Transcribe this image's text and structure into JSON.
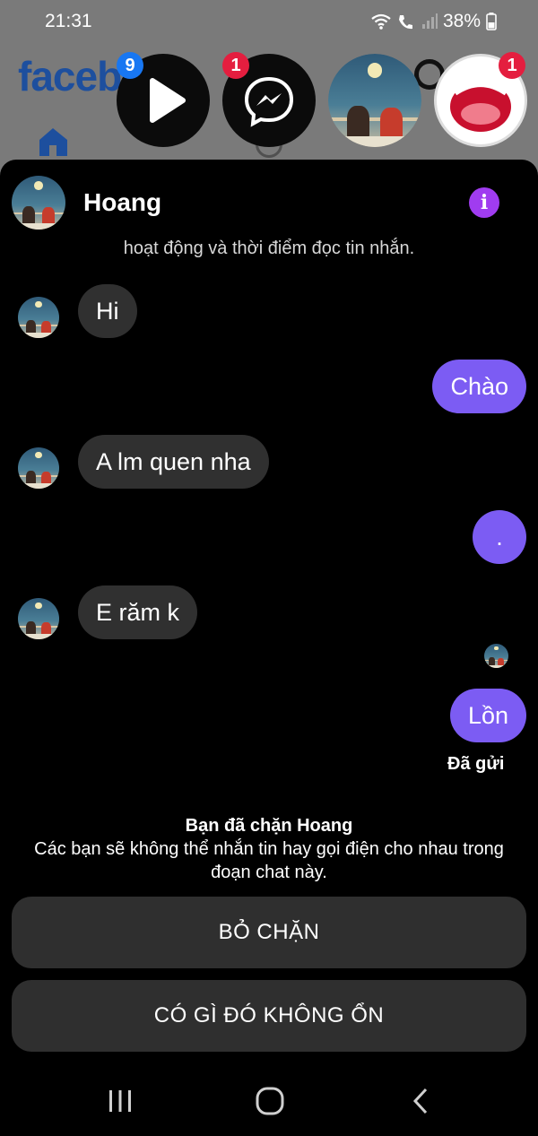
{
  "status_bar": {
    "time": "21:31",
    "battery": "38%"
  },
  "background_app": {
    "logo_text": "facebook",
    "brand_color": "#1d4f9e"
  },
  "chat_heads": {
    "video_badge": "9",
    "messenger_badge": "1",
    "sticker_badge": "1"
  },
  "chat": {
    "contact_name": "Hoang",
    "accent_color": "#7c5cf3",
    "info_color": "#a03cf0",
    "clipped_notice": "hoạt động và thời điểm đọc tin nhắn.",
    "messages": [
      {
        "direction": "in",
        "text": "Hi"
      },
      {
        "direction": "out",
        "text": "Chào"
      },
      {
        "direction": "in",
        "text": "A lm quen nha"
      },
      {
        "direction": "out",
        "text": "."
      },
      {
        "direction": "in",
        "text": "E răm k"
      },
      {
        "direction": "out",
        "text": "Lồn"
      }
    ],
    "sent_status": "Đã gửi",
    "blocked_title": "Bạn đã chặn Hoang",
    "blocked_description": "Các bạn sẽ không thể nhắn tin hay gọi điện cho nhau trong đoạn chat này.",
    "unblock_label": "BỎ CHẶN",
    "report_label": "CÓ GÌ ĐÓ KHÔNG ỔN"
  },
  "icons": {
    "info": "info-icon",
    "home": "home-icon",
    "video": "play-icon",
    "messenger": "messenger-icon",
    "nav_recents": "recents-icon",
    "nav_home": "home-circle-icon",
    "nav_back": "back-icon"
  }
}
